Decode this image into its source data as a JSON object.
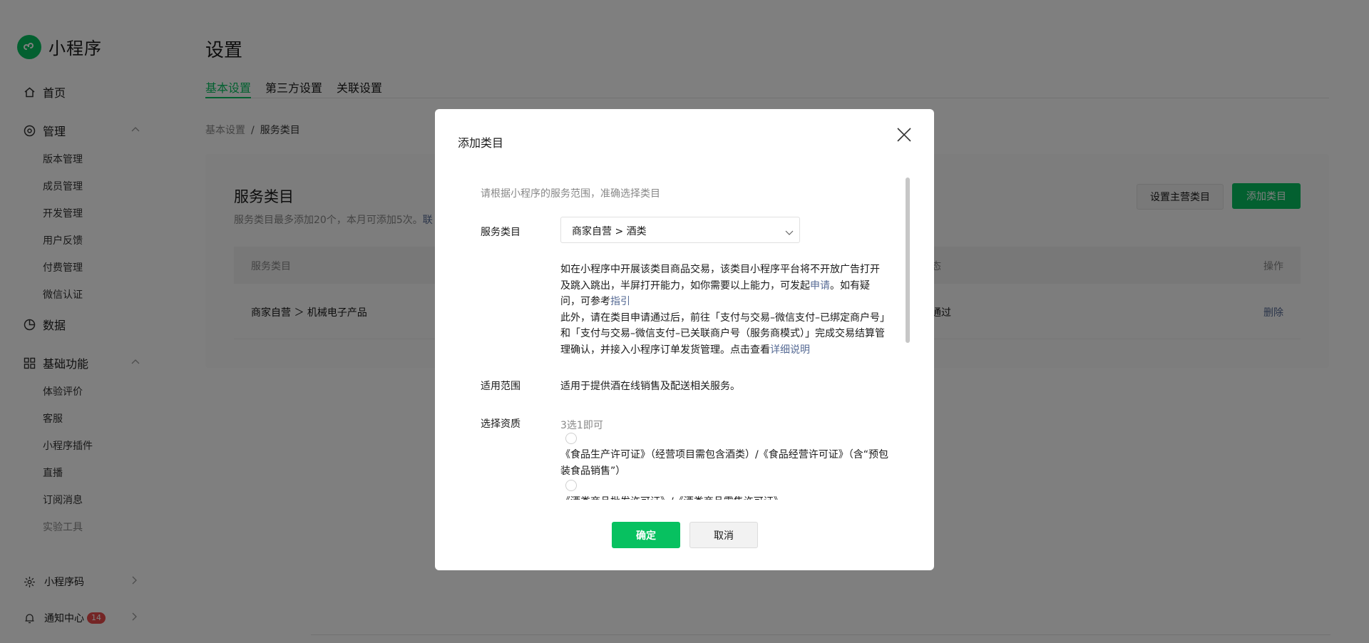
{
  "brand": {
    "name": "小程序"
  },
  "sidebar": {
    "home": "首页",
    "manage": {
      "label": "管理",
      "items": [
        "版本管理",
        "成员管理",
        "开发管理",
        "用户反馈",
        "付费管理",
        "微信认证"
      ]
    },
    "data": "数据",
    "basic": {
      "label": "基础功能",
      "items": [
        "体验评价",
        "客服",
        "小程序插件",
        "直播",
        "订阅消息",
        "实验工具"
      ]
    },
    "qrcode": "小程序码",
    "notify": {
      "label": "通知中心",
      "count": "14"
    }
  },
  "page": {
    "title": "设置",
    "tabs": [
      "基本设置",
      "第三方设置",
      "关联设置"
    ],
    "breadcrumb": {
      "parent": "基本设置",
      "sep": "/",
      "current": "服务类目"
    }
  },
  "service_card": {
    "title": "服务类目",
    "desc": "服务类目最多添加20个，本月可添加5次。",
    "desc_link": "联",
    "set_main_button": "设置主营类目",
    "add_button": "添加类目",
    "table": {
      "col_category": "服务类目",
      "col_status": "态",
      "col_action": "操作",
      "row": {
        "category": "商家自营 ＞ 机械电子产品",
        "status": "通过",
        "action": "删除"
      }
    }
  },
  "modal": {
    "title": "添加类目",
    "hint": "请根据小程序的服务范围，准确选择类目",
    "service_category_label": "服务类目",
    "selected_category": "商家自营 > 酒类",
    "info1_text": "如在小程序中开展该类目商品交易，该类目小程序平台将不开放广告打开及跳入跳出，半屏打开能力，如你需要以上能力，可发起",
    "info1_link": "申请",
    "info1_tail": "。如有疑问，可参考",
    "info1_link2": "指引",
    "info2_text": "此外，请在类目申请通过后，前往「支付与交易–微信支付–已绑定商户号」和「支付与交易–微信支付–已关联商户号（服务商模式）」完成交易结算管理确认，并接入小程序订单发货管理。点击查看",
    "info2_link": "详细说明",
    "scope_label": "适用范围",
    "scope_value": "适用于提供酒在线销售及配送相关服务。",
    "qualification_label": "选择资质",
    "qualification_hint": "3选1即可",
    "options": [
      "《食品生产许可证》（经营项目需包含酒类）/《食品经营许可证》（含“预包装食品销售”）",
      "《酒类商品批发许可证》/《酒类商品零售许可证》"
    ],
    "confirm": "确定",
    "cancel": "取消"
  },
  "colors": {
    "accent": "#07c160",
    "link": "#576b95",
    "badge": "#e84b4b"
  }
}
